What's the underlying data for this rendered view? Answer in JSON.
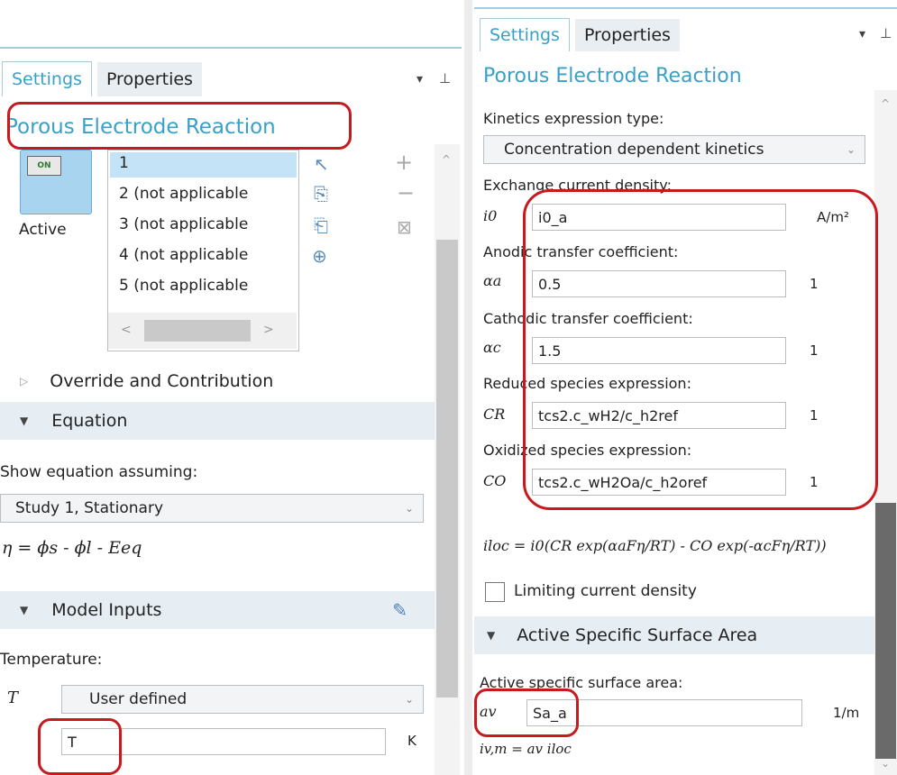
{
  "left": {
    "tabs": [
      "Settings",
      "Properties"
    ],
    "title": "Porous Electrode Reaction",
    "toggle": "ON",
    "active_label": "Active",
    "list_items": [
      "1",
      "2 (not applicable",
      "3 (not applicable",
      "4 (not applicable",
      "5 (not applicable"
    ],
    "sections": {
      "override": "Override and Contribution",
      "equation": "Equation",
      "model_inputs": "Model Inputs"
    },
    "show_equation_label": "Show equation assuming:",
    "study_select": "Study 1, Stationary",
    "equation_text": "η = ϕs - ϕl - Eeq",
    "temperature_label": "Temperature:",
    "temperature_symbol": "T",
    "temperature_mode": "User defined",
    "temperature_value": "T",
    "temperature_unit": "K"
  },
  "right": {
    "tabs": [
      "Settings",
      "Properties"
    ],
    "title": "Porous Electrode Reaction",
    "kinetics_label": "Kinetics expression type:",
    "kinetics_select": "Concentration dependent kinetics",
    "params": [
      {
        "label": "Exchange current density:",
        "symbol": "i0",
        "value": "i0_a",
        "unit": "A/m²"
      },
      {
        "label": "Anodic transfer coefficient:",
        "symbol": "αa",
        "value": "0.5",
        "unit": "1"
      },
      {
        "label": "Cathodic transfer coefficient:",
        "symbol": "αc",
        "value": "1.5",
        "unit": "1"
      },
      {
        "label": "Reduced species expression:",
        "symbol": "CR",
        "value": "tcs2.c_wH2/c_h2ref",
        "unit": "1"
      },
      {
        "label": "Oxidized species expression:",
        "symbol": "CO",
        "value": "tcs2.c_wH2Oa/c_h2oref",
        "unit": "1"
      }
    ],
    "equation_text": "iloc = i0(CR exp(αaFη/RT) - CO exp(-αcFη/RT))",
    "limiting_label": "Limiting current density",
    "section_asa": "Active Specific Surface Area",
    "asa_label": "Active specific surface area:",
    "asa_symbol": "av",
    "asa_value": "Sa_a",
    "asa_unit": "1/m",
    "bottom_equation": "iv,m = av iloc"
  },
  "highlight_color": "#c8191f",
  "accent_color": "#3aa0c8"
}
